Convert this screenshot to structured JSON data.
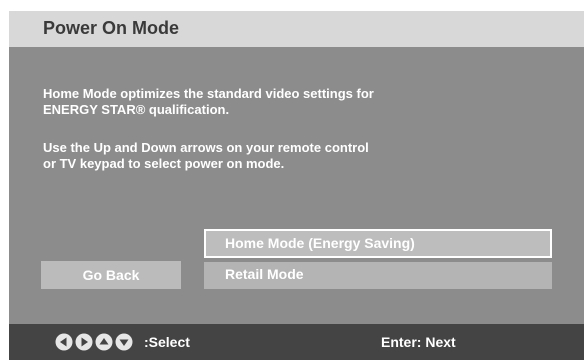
{
  "title": "Power On Mode",
  "description": {
    "para1": [
      "Home Mode optimizes the standard video settings for",
      "ENERGY STAR® qualification."
    ],
    "para2": [
      "Use the Up and Down arrows on your remote control",
      "or TV keypad to select power on mode."
    ]
  },
  "options": [
    {
      "label": "Home Mode (Energy Saving)",
      "selected": true
    },
    {
      "label": "Retail Mode",
      "selected": false
    }
  ],
  "go_back_label": "Go Back",
  "footer": {
    "arrow_icons": [
      "arrow-left-icon",
      "arrow-right-icon",
      "arrow-up-icon",
      "arrow-down-icon"
    ],
    "select_label": ":Select",
    "enter_label": "Enter: Next"
  },
  "colors": {
    "background": "#8c8c8c",
    "title_bar": "#d8d8d8",
    "bottom_bar": "#444444",
    "text": "#ffffff"
  }
}
